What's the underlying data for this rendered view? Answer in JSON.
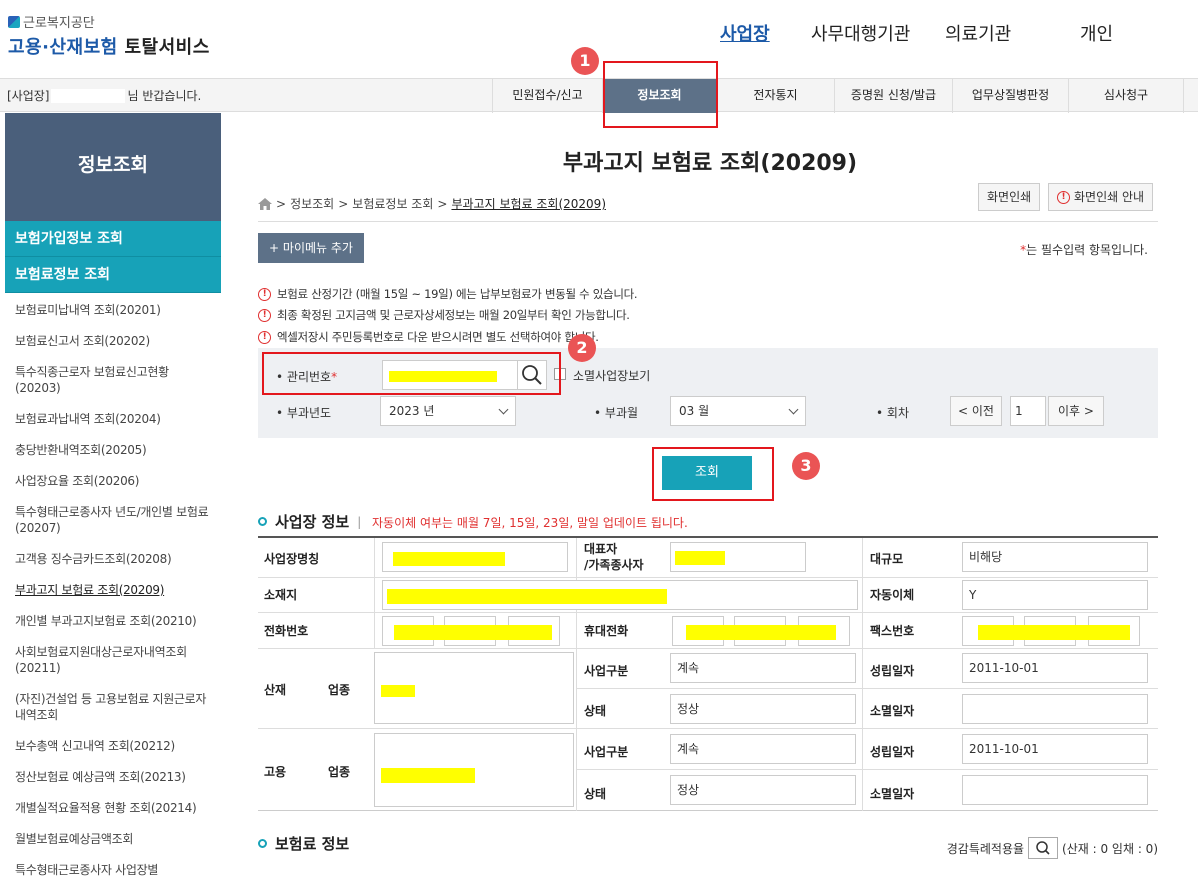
{
  "header": {
    "org_name": "근로복지공단",
    "service_name_blue": "고용·산재보험",
    "service_name_dark": "토탈서비스",
    "user_types": [
      "사업장",
      "사무대행기관",
      "의료기관",
      "개인"
    ]
  },
  "subbar": {
    "greeting_prefix": "[사업장]",
    "greeting_suffix": "님 반갑습니다.",
    "nav": [
      "민원접수/신고",
      "정보조회",
      "전자통지",
      "증명원 신청/발급",
      "업무상질병판정",
      "심사청구"
    ]
  },
  "sidebar": {
    "title": "정보조회",
    "sections": [
      "보험가입정보 조회",
      "보험료정보 조회"
    ],
    "items": [
      "보험료미납내역 조회(20201)",
      "보험료신고서 조회(20202)",
      "특수직종근로자 보험료신고현황 (20203)",
      "보험료과납내역 조회(20204)",
      "충당반환내역조회(20205)",
      "사업장요율 조회(20206)",
      "특수형태근로종사자 년도/개인별 보험료(20207)",
      "고객용 징수금카드조회(20208)",
      "부과고지 보험료 조회(20209)",
      "개인별 부과고지보험료 조회(20210)",
      "사회보험료지원대상근로자내역조회 (20211)",
      "(자진)건설업 등 고용보험료 지원근로자 내역조회",
      "보수총액 신고내역 조회(20212)",
      "정산보험료 예상금액 조회(20213)",
      "개별실적요율적용 현황 조회(20214)",
      "월별보험료예상금액조회",
      "특수형태근로종사자 사업장별"
    ]
  },
  "main": {
    "page_title": "부과고지 보험료 조회(20209)",
    "breadcrumb": [
      "정보조회",
      "보험료정보 조회",
      "부과고지 보험료 조회(20209)"
    ],
    "print_button": "화면인쇄",
    "print_guide_button": "화면인쇄 안내",
    "mymenu_button": "+ 마이메뉴 추가",
    "required_note": "는 필수입력 항목입니다.",
    "required_star": "*",
    "notices": [
      "보험료 산정기간 (매월 15일 ~ 19일) 에는 납부보험료가 변동될 수 있습니다.",
      "최종 확정된 고지금액 및 근로자상세정보는 매월 20일부터 확인 가능합니다.",
      "엑셀저장시 주민등록번호로 다운 받으시려면 별도 선택하여야 합니다."
    ],
    "search": {
      "mgmt_no_label": "관리번호",
      "closed_label": "소멸사업장보기",
      "year_label": "부과년도",
      "year_value": "2023 년",
      "month_label": "부과월",
      "month_value": "03 월",
      "round_label": "회차",
      "prev_button": "< 이전",
      "round_value": "1",
      "next_button": "이후 >"
    },
    "query_button": "조회",
    "badges": [
      "1",
      "2",
      "3"
    ],
    "biz_info": {
      "title": "사업장 정보",
      "autopay_note": "자동이체 여부는 매월 7일, 15일, 23일, 말일 업데이트 됩니다.",
      "name_label": "사업장명칭",
      "rep_label_1": "대표자",
      "rep_label_2": "/가족종사자",
      "scale_label": "대규모",
      "scale_value": "비해당",
      "addr_label": "소재지",
      "autopay_label": "자동이체",
      "autopay_value": "Y",
      "phone_label": "전화번호",
      "mobile_label": "휴대전화",
      "fax_label": "팩스번호",
      "sanjae": "산재",
      "goyong": "고용",
      "industry_label": "업종",
      "biz_type_label": "사업구분",
      "biz_type_value": "계속",
      "est_date_label": "성립일자",
      "est_date_value": "2011-10-01",
      "status_label": "상태",
      "status_value": "정상",
      "close_date_label": "소멸일자"
    },
    "premium_info": {
      "title": "보험료 정보",
      "reduction_label": "경감특례적용율",
      "reduction_value": "(산재 : 0 임채 : 0)"
    }
  },
  "colors": {
    "accent": "#17a2b8",
    "nav_active": "#5d7188",
    "sidebar_head": "#4a5f7b",
    "highlight": "#ffff00",
    "annotation_red": "#e3171d"
  }
}
